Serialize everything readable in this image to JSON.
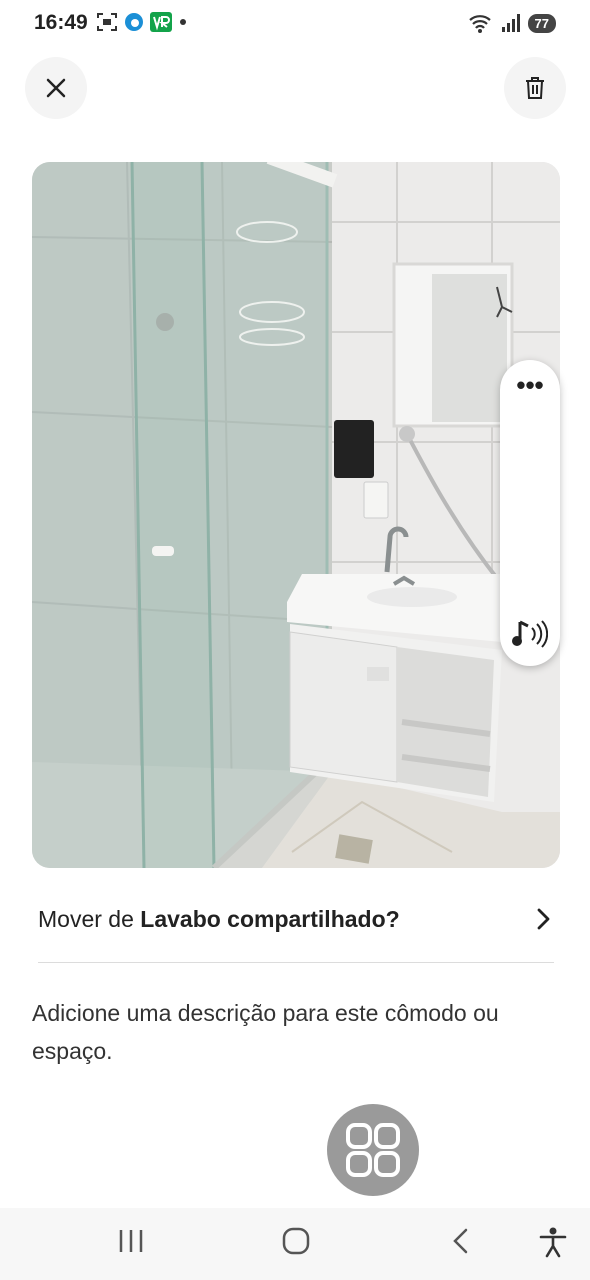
{
  "status_bar": {
    "time": "16:49",
    "battery": "77",
    "icons_left": [
      "screenshot-icon",
      "edge-browser-icon",
      "vr-app-icon",
      "notification-dot-icon"
    ],
    "icons_right": [
      "wifi-icon",
      "signal-icon",
      "battery-icon"
    ]
  },
  "header": {
    "close_icon": "close-icon",
    "delete_icon": "trash-icon"
  },
  "photo": {
    "subject": "bathroom-photo",
    "side_panel": {
      "more_icon": "more-options-icon",
      "more_label": "•••",
      "audio_icon": "audio-description-icon"
    }
  },
  "move": {
    "prefix": "Mover de ",
    "room": "Lavabo compartilhado",
    "suffix": "?",
    "chevron": "chevron-right-icon"
  },
  "description": {
    "placeholder": "Adicione uma descrição para este cômodo ou espaço."
  },
  "fab": {
    "icon": "grid-view-icon"
  },
  "nav": {
    "items": [
      "recent-apps-icon",
      "home-icon",
      "back-icon",
      "accessibility-icon"
    ]
  },
  "colors": {
    "fab_bg": "#9a9a9a",
    "button_bg": "#f4f4f4",
    "battery_bg": "#444444"
  }
}
